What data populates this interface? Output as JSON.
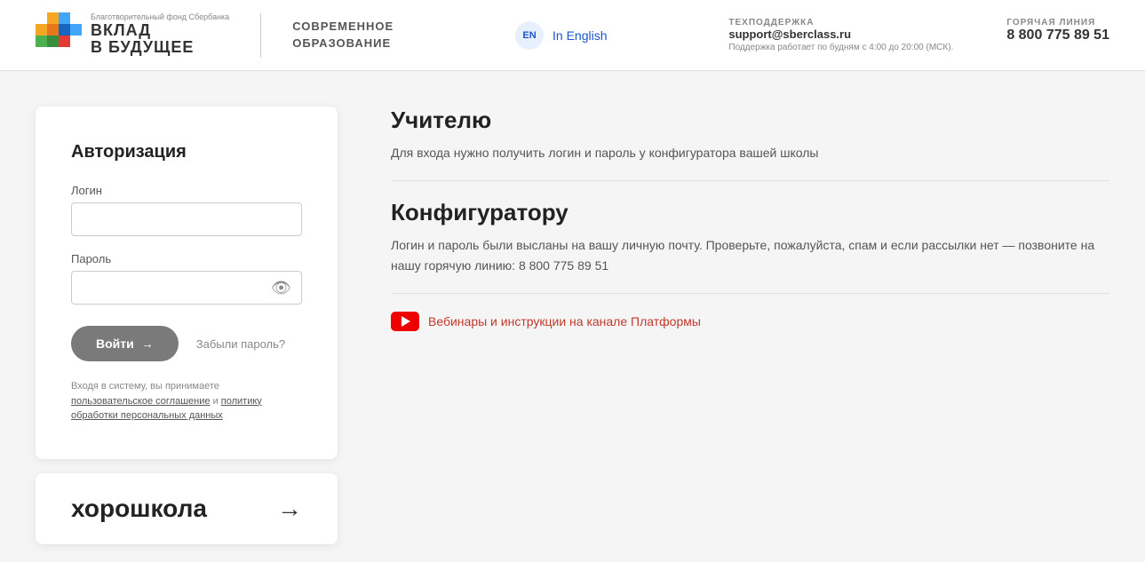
{
  "header": {
    "logo_small": "Благотворительный фонд Сбербанка",
    "logo_main1": "ВКЛАД",
    "logo_main2": "В БУДУЩЕЕ",
    "subtitle_line1": "СОВРЕМЕННОЕ",
    "subtitle_line2": "ОБРАЗОВАНИЕ",
    "lang_badge": "EN",
    "lang_link": "In English",
    "support_label": "ТЕХПОДДЕРЖКА",
    "support_email": "support@sberclass.ru",
    "support_note": "Поддержка работает по будням с 4:00 до 20:00 (МСК).",
    "hotline_label": "ГОРЯЧАЯ ЛИНИЯ",
    "hotline_number": "8 800 775 89 51"
  },
  "auth": {
    "title": "Авторизация",
    "login_label": "Логин",
    "login_placeholder": "",
    "password_label": "Пароль",
    "password_placeholder": "",
    "login_button": "Войти",
    "forgot_link": "Забыли пароль?",
    "terms_text": "Входя в систему, вы принимаете",
    "terms_link1": "пользовательское соглашение",
    "terms_and": " и ",
    "terms_link2": "политику обработки персональных данных"
  },
  "bottom_card": {
    "text": "хорошкола",
    "arrow": "→"
  },
  "info": {
    "teacher_title": "Учителю",
    "teacher_text": "Для входа нужно получить логин и пароль у конфигуратора вашей школы",
    "configurator_title": "Конфигуратору",
    "configurator_text": "Логин и пароль были высланы на вашу личную почту. Проверьте, пожалуйста, спам и если рассылки нет — позвоните на нашу горячую линию: 8 800 775 89 51",
    "youtube_link": "Вебинары и инструкции на канале Платформы"
  }
}
